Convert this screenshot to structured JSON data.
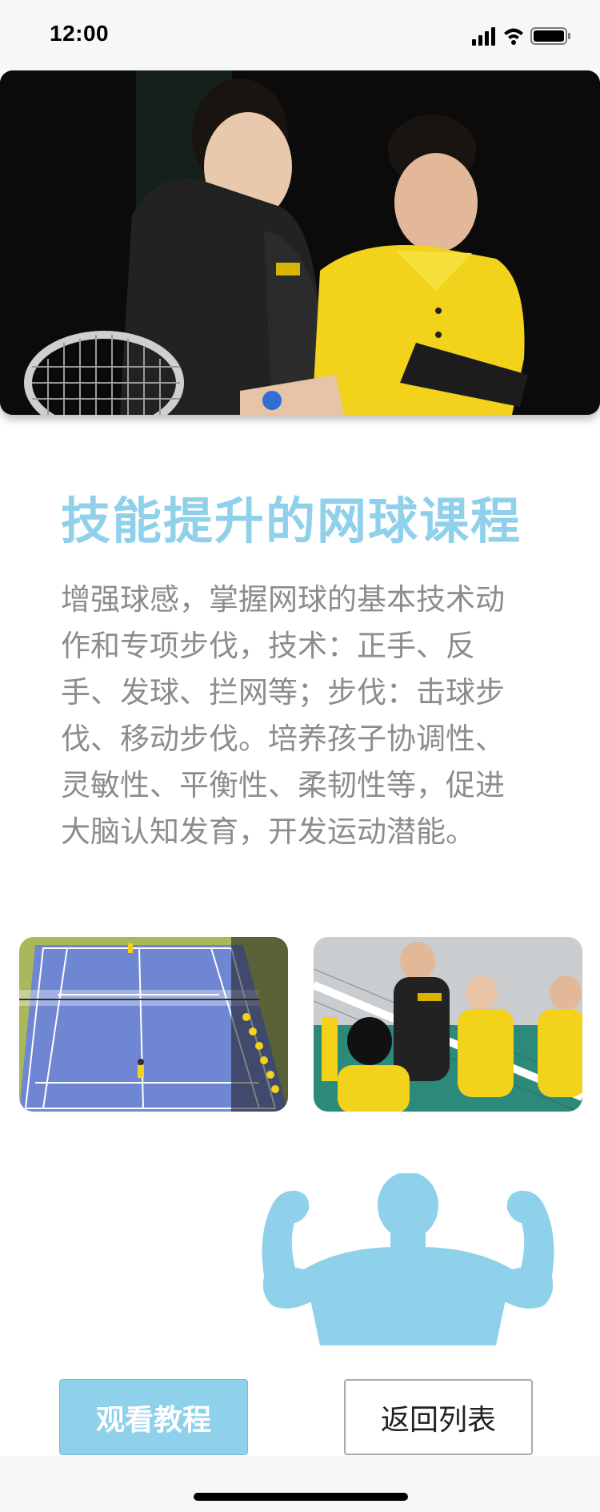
{
  "status_bar": {
    "time": "12:00"
  },
  "course": {
    "title": "技能提升的网球课程",
    "description": "增强球感，掌握网球的基本技术动作和专项步伐，技术：正手、反手、发球、拦网等；步伐：击球步伐、移动步伐。培养孩子协调性、灵敏性、平衡性、柔韧性等，促进大脑认知发育，开发运动潜能。"
  },
  "actions": {
    "watch_label": "观看教程",
    "back_label": "返回列表"
  },
  "colors": {
    "accent": "#8fd0ea",
    "text_gray": "#8c8c8c",
    "mascot": "#8fd0ea"
  },
  "icons": {
    "signal": "signal-icon",
    "wifi": "wifi-icon",
    "battery": "battery-icon",
    "mascot": "strong-man-icon"
  }
}
